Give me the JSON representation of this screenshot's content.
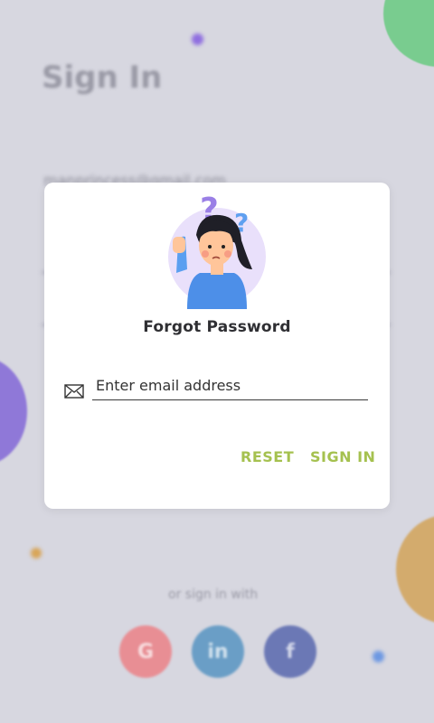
{
  "background": {
    "title": "Sign In",
    "email_value": "manprincess@gmail.com",
    "or_text": "or sign in with",
    "social": [
      {
        "name": "google",
        "glyph": "G",
        "color": "#e88e94"
      },
      {
        "name": "linkedin",
        "glyph": "in",
        "color": "#6a9ec6"
      },
      {
        "name": "facebook",
        "glyph": "f",
        "color": "#6b78b5"
      }
    ]
  },
  "dialog": {
    "title": "Forgot Password",
    "email_placeholder": "Enter email address",
    "email_value": "",
    "reset_label": "RESET",
    "signin_label": "SIGN IN",
    "icons": {
      "mail": "mail-icon",
      "avatar": "confused-girl-illustration"
    }
  },
  "colors": {
    "accent": "#a5c14f",
    "overlay": "#d7d7e0",
    "avatar_circle": "#e9e0fb"
  }
}
